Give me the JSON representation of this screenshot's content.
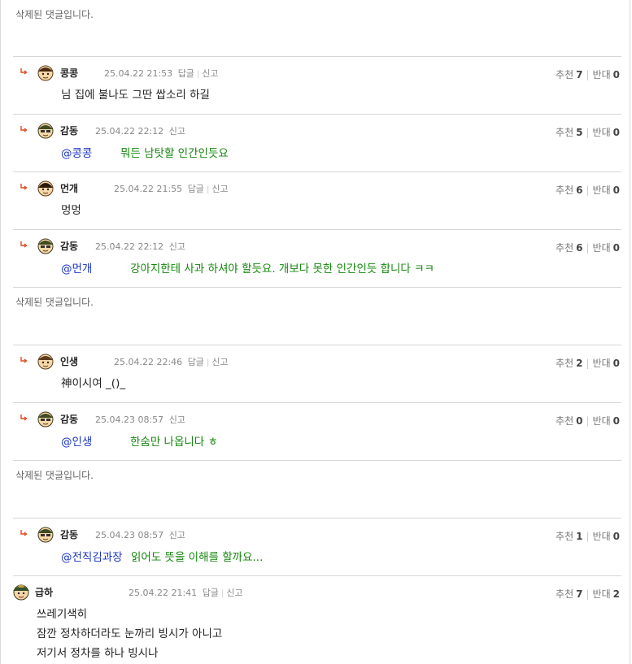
{
  "deleted_text": "삭제된 댓글입니다.",
  "labels": {
    "reply": "답글",
    "report": "신고",
    "up": "추천",
    "down": "반대"
  },
  "comments": [
    {
      "author": "콩콩",
      "date": "25.04.22 21:53",
      "up": "7",
      "down": "0",
      "mention": "",
      "text": "님 집에 불나도 그딴 쌉소리 하길"
    },
    {
      "author": "감동",
      "date": "25.04.22 22:12",
      "up": "5",
      "down": "0",
      "mention": "@콩콩",
      "text": "뭐든 남탓할 인간인듯요"
    },
    {
      "author": "먼개",
      "date": "25.04.22 21:55",
      "up": "6",
      "down": "0",
      "mention": "",
      "text": "멍멍"
    },
    {
      "author": "감동",
      "date": "25.04.22 22:12",
      "up": "6",
      "down": "0",
      "mention": "@먼개",
      "text": "강아지한테 사과 하셔야 할듯요. 개보다 못한 인간인듯 합니다 ㅋㅋ"
    },
    {
      "author": "인생",
      "date": "25.04.22 22:46",
      "up": "2",
      "down": "0",
      "mention": "",
      "text": "神이시여 _()_"
    },
    {
      "author": "감동",
      "date": "25.04.23 08:57",
      "up": "0",
      "down": "0",
      "mention": "@인생",
      "text": "한숨만 나옵니다 ㅎ"
    },
    {
      "author": "감동",
      "date": "25.04.23 08:57",
      "up": "1",
      "down": "0",
      "mention": "@전직김과장",
      "text": "읽어도 뜻을 이해를 할까요..."
    },
    {
      "author": "급하",
      "date": "25.04.22 21:41",
      "up": "7",
      "down": "2",
      "mention": "",
      "lines": [
        "쓰레기색히",
        "잠깐 정차하더라도 눈까리 빙시가 아니고",
        "저기서 정차를 하나 빙시나"
      ]
    }
  ],
  "icons": {
    "reply_arrow": "reply-arrow-icon",
    "avatar": "avatar-icon"
  },
  "colors": {
    "mention": "#1a35c4",
    "reply_text": "#16870d",
    "arrow": "#e0461c"
  }
}
